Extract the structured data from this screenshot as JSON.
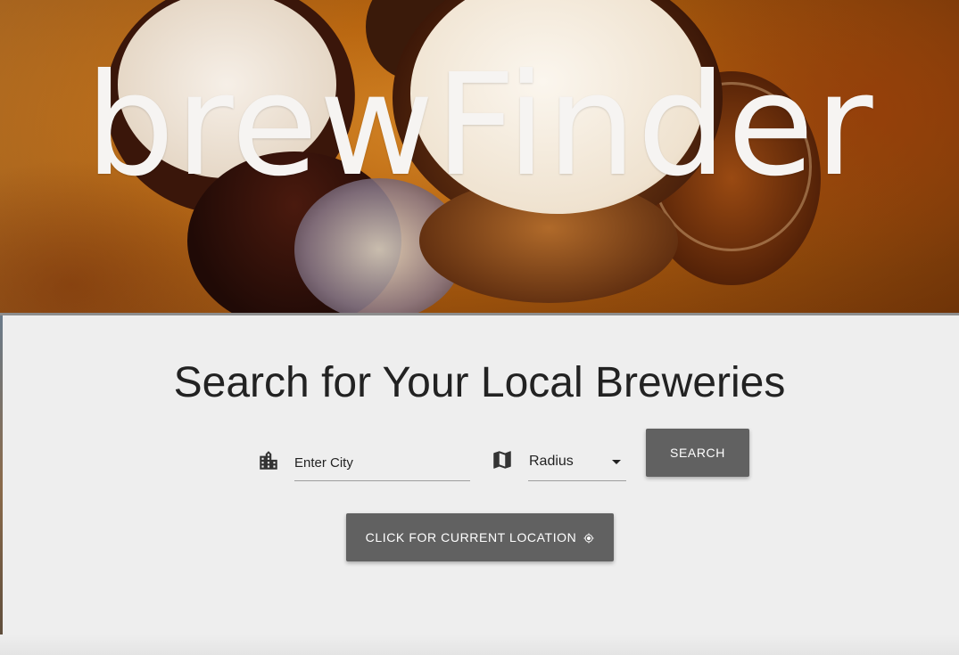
{
  "hero": {
    "title": "brewFinder"
  },
  "main": {
    "heading": "Search for Your Local Breweries",
    "city_input": {
      "placeholder": "Enter City",
      "value": "",
      "icon": "city-icon"
    },
    "radius_select": {
      "selected": "Radius",
      "icon": "map-icon"
    },
    "search_button": "SEARCH",
    "location_button": {
      "label": "CLICK FOR CURRENT LOCATION",
      "icon": "my-location-icon"
    }
  },
  "colors": {
    "background": "#eeeeee",
    "button": "#616161",
    "button_text": "#ffffff",
    "heading_text": "#222222",
    "hero_title": "#f6f4f2"
  }
}
